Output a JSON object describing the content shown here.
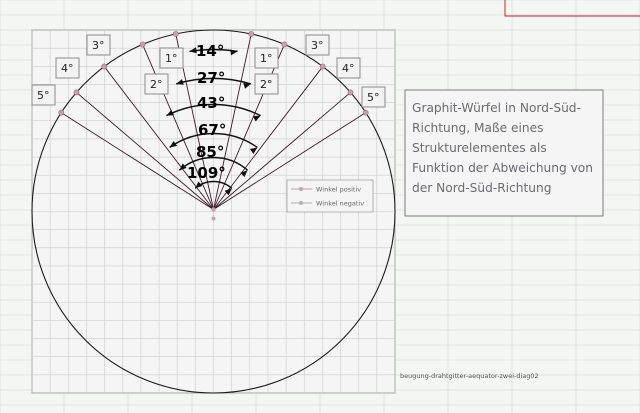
{
  "sheet": {
    "accent_red": "#d0202a",
    "file_label": "beugung-drahtgitter-aequator-zwei-diag02"
  },
  "caption": {
    "lines": [
      "Graphit-Würfel in Nord-Süd-",
      "Richtung, Maße eines",
      "Strukturelementes als",
      "Funktion der Abweichung von",
      "der Nord-Süd-Richtung"
    ]
  },
  "legend": {
    "items": [
      {
        "label": "Winkel positiv",
        "color": "#c8a0b0"
      },
      {
        "label": "Winkel negativ",
        "color": "#b0b0b0"
      }
    ]
  },
  "chart_data": {
    "type": "scatter",
    "title": "",
    "xlabel": "",
    "ylabel": "",
    "xlim": [
      -10,
      10
    ],
    "ylim": [
      -10,
      10
    ],
    "grid": true,
    "legend_position": "right",
    "circle": {
      "cx": 0,
      "cy": 0,
      "r": 10
    },
    "origin": [
      0,
      0
    ],
    "rays": [
      {
        "deviation_deg": 5,
        "side": "positive"
      },
      {
        "deviation_deg": 4,
        "side": "positive"
      },
      {
        "deviation_deg": 3,
        "side": "positive"
      },
      {
        "deviation_deg": 2,
        "side": "positive"
      },
      {
        "deviation_deg": 1,
        "side": "positive"
      },
      {
        "deviation_deg": 5,
        "side": "negative"
      },
      {
        "deviation_deg": 4,
        "side": "negative"
      },
      {
        "deviation_deg": 3,
        "side": "negative"
      },
      {
        "deviation_deg": 2,
        "side": "negative"
      },
      {
        "deviation_deg": 1,
        "side": "negative"
      }
    ],
    "ray_angles_from_vertical_deg": [
      57,
      49,
      37,
      23,
      12
    ],
    "angle_labels": [
      "14°",
      "27°",
      "43°",
      "67°",
      "85°",
      "109°"
    ],
    "deviation_labels": [
      {
        "text": "5°",
        "side": "left"
      },
      {
        "text": "4°",
        "side": "left"
      },
      {
        "text": "3°",
        "side": "left"
      },
      {
        "text": "2°",
        "side": "left"
      },
      {
        "text": "1°",
        "side": "left"
      },
      {
        "text": "1°",
        "side": "right"
      },
      {
        "text": "2°",
        "side": "right"
      },
      {
        "text": "3°",
        "side": "right"
      },
      {
        "text": "4°",
        "side": "right"
      },
      {
        "text": "5°",
        "side": "right"
      }
    ]
  }
}
